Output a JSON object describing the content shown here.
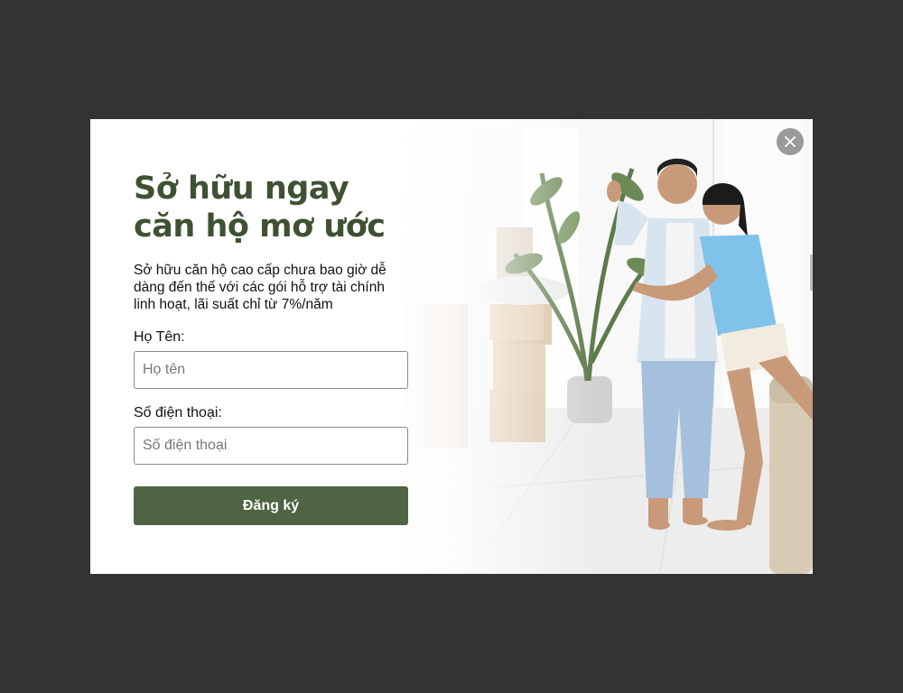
{
  "popup": {
    "title": "Sở hữu ngay căn hộ mơ ước",
    "description": "Sở hữu căn hộ cao cấp chưa bao giờ dễ dàng đến thế với các gói hỗ trợ tài chính linh hoạt, lãi suất chỉ từ 7%/năm",
    "name_label": "Họ Tên:",
    "name_placeholder": "Họ tên",
    "name_value": "",
    "phone_label": "Số điện thoại:",
    "phone_placeholder": "Số điện thoại",
    "phone_value": "",
    "submit_label": "Đăng ký",
    "close_icon": "close-icon"
  },
  "colors": {
    "backdrop": "#333333",
    "title": "#3f5133",
    "button": "#4e6442",
    "close_button": "#9a9a9a"
  }
}
